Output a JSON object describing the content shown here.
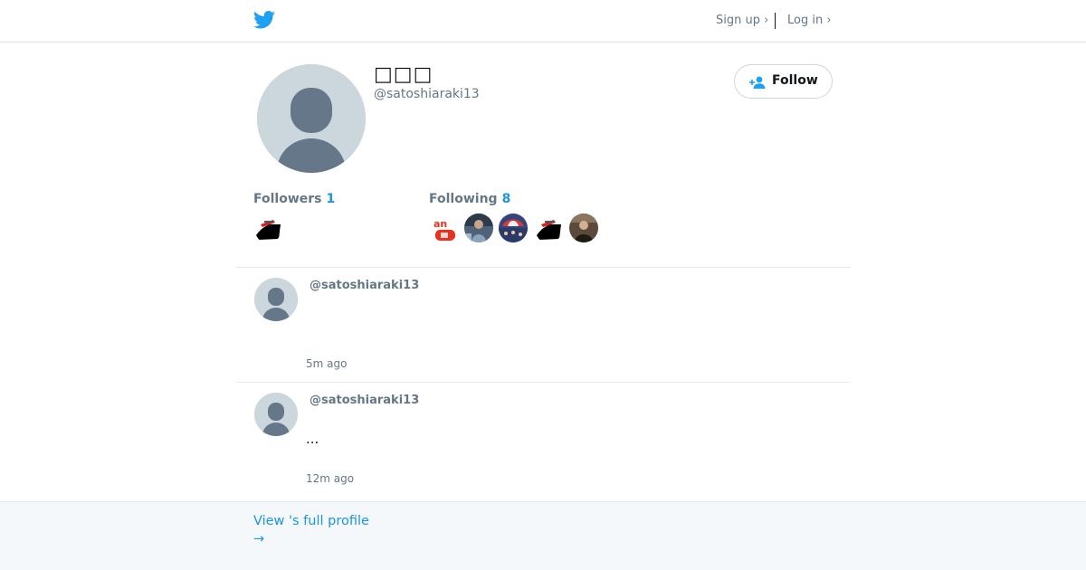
{
  "header": {
    "sign_up": "Sign up ›",
    "log_in": "Log in ›"
  },
  "profile": {
    "name": "□□□",
    "handle": "@satoshiaraki13",
    "follow_label": "Follow",
    "followers_label": "Followers",
    "followers_count": "1",
    "following_label": "Following",
    "following_count": "8"
  },
  "tweets": [
    {
      "handle": "@satoshiaraki13",
      "text": "",
      "time": "5m ago"
    },
    {
      "handle": "@satoshiaraki13",
      "text": "...",
      "time": "12m ago"
    }
  ],
  "footer": {
    "view_profile": "View 's full profile",
    "arrow": "→"
  },
  "colors": {
    "accent": "#1b95e0",
    "twitter_blue": "#1da1f2",
    "muted": "#657786",
    "border": "#e6ecf0",
    "footer_bg": "#f5f8fa"
  },
  "icons": {
    "logo": "twitter-bird-icon",
    "follow": "person-add-icon"
  }
}
